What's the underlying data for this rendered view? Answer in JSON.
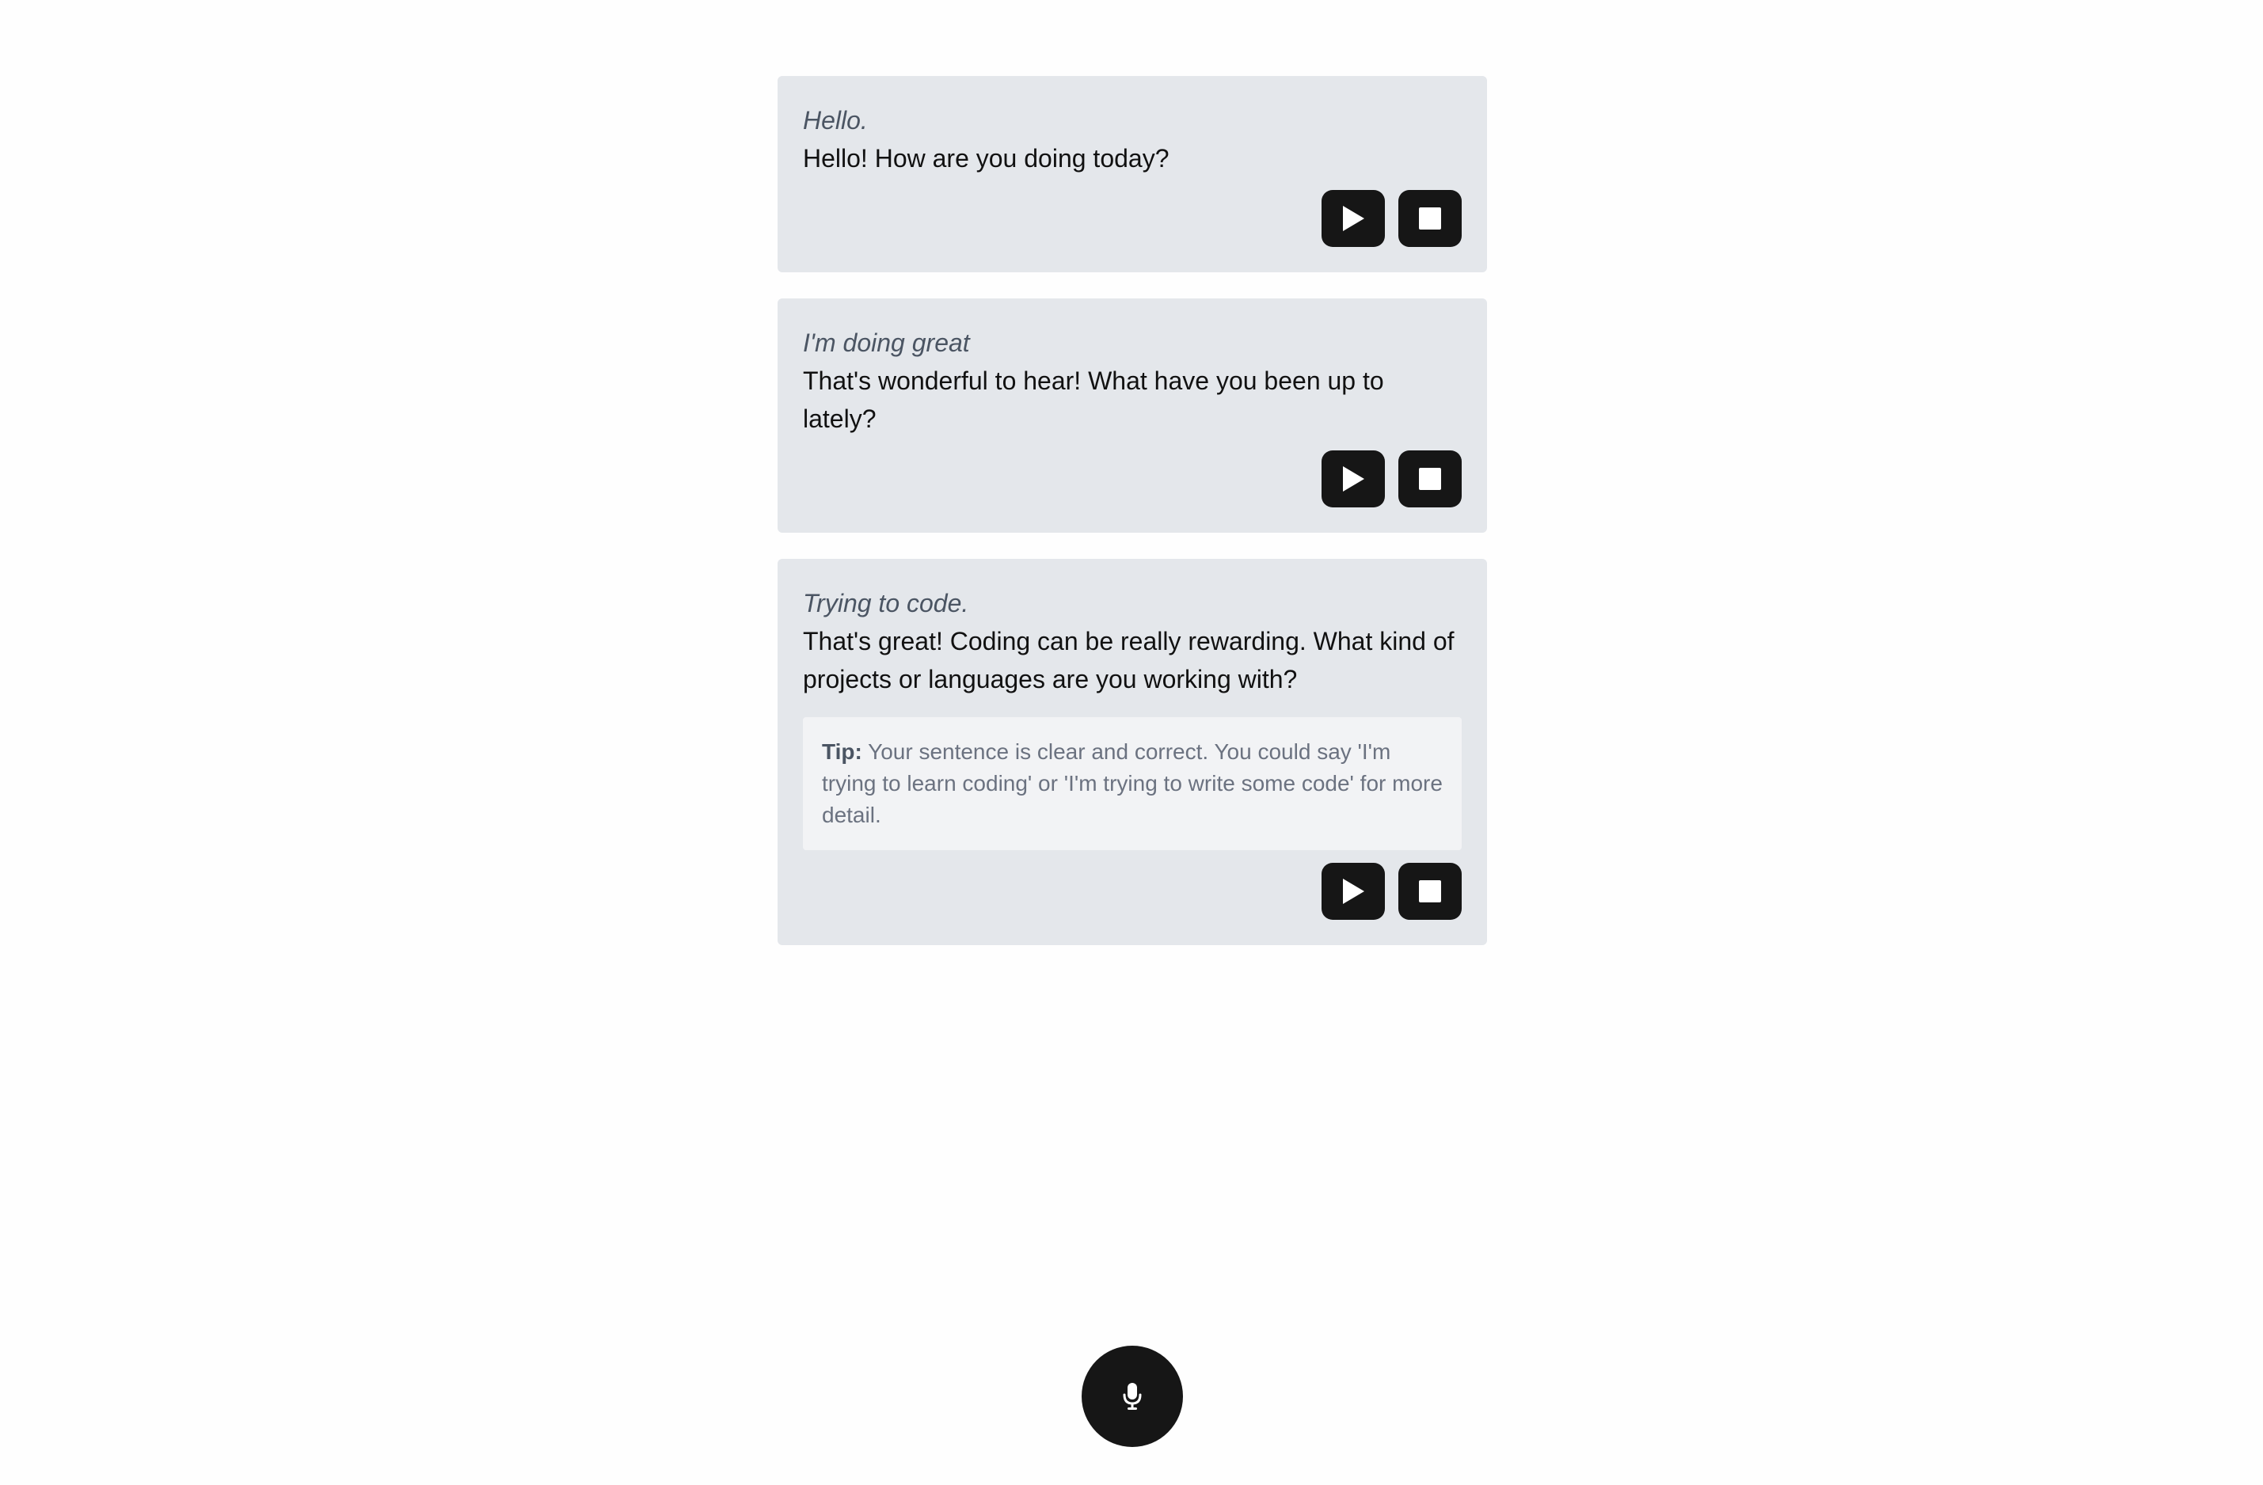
{
  "messages": [
    {
      "user_text": "Hello.",
      "reply_text": "Hello! How are you doing today?",
      "tip": null
    },
    {
      "user_text": "I'm doing great",
      "reply_text": "That's wonderful to hear! What have you been up to lately?",
      "tip": null
    },
    {
      "user_text": "Trying to code.",
      "reply_text": "That's great! Coding can be really rewarding. What kind of projects or languages are you working with?",
      "tip": {
        "label": "Tip:",
        "text": " Your sentence is clear and correct. You could say 'I'm trying to learn coding' or 'I'm trying to write some code' for more detail."
      }
    }
  ],
  "icons": {
    "play": "play-icon",
    "stop": "stop-icon",
    "mic": "microphone-icon"
  },
  "colors": {
    "card_background": "#e4e7eb",
    "tip_background": "#f2f3f5",
    "button_background": "#161616",
    "page_background": "#fefefe"
  }
}
